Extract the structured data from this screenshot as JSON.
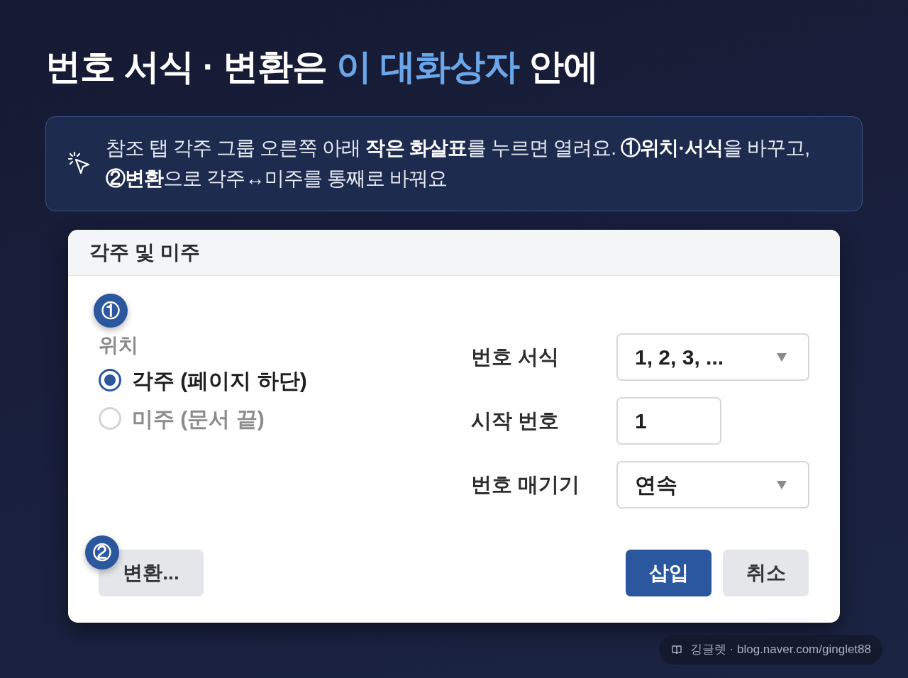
{
  "title": [
    {
      "text": "번호 서식 · 변환은 ",
      "highlight": false
    },
    {
      "text": "이 대화상자",
      "highlight": true
    },
    {
      "text": " 안에",
      "highlight": false
    }
  ],
  "callout": {
    "text": "참조 탭 각주 그룹 오른쪽 아래 **작은 화살표**를 누르면 열려요. **①위치·서식**을 바꾸고, **②변환**으로 각주↔미주를 통째로 바꿔요"
  },
  "dialog": {
    "title": "각주 및 미주",
    "location_group": {
      "marker": "①",
      "label": "위치",
      "options": [
        {
          "label": "각주 (페이지 하단)",
          "selected": true
        },
        {
          "label": "미주 (문서 끝)",
          "selected": false
        }
      ]
    },
    "fields": [
      {
        "kind": "select",
        "label": "번호 서식",
        "value": "1, 2, 3, ..."
      },
      {
        "kind": "input",
        "label": "시작 번호",
        "value": "1"
      },
      {
        "kind": "select",
        "label": "번호 매기기",
        "value": "연속"
      }
    ],
    "convert_button": {
      "label": "변환...",
      "marker": "②"
    },
    "buttons": [
      {
        "label": "삽입",
        "kind": "primary"
      },
      {
        "label": "취소",
        "kind": "secondary"
      }
    ]
  },
  "credit": {
    "text": "깅글렛 · blog.naver.com/ginglet88"
  }
}
